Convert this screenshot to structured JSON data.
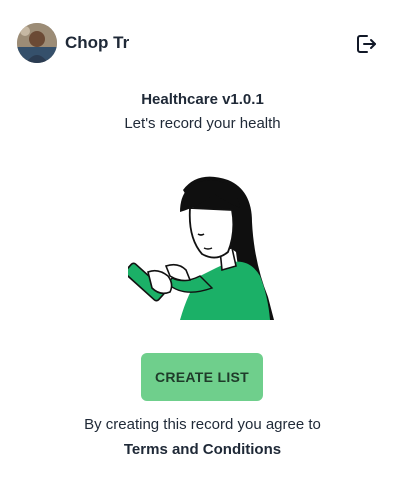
{
  "header": {
    "user_name": "Chop Tr",
    "avatar_icon": "user-avatar",
    "logout_icon": "logout-icon"
  },
  "main": {
    "title": "Healthcare v1.0.1",
    "subtitle": "Let's record your health",
    "illustration_icon": "woman-with-phone-illustration",
    "create_button_label": "CREATE LIST",
    "agree_text": "By creating this record you agree to",
    "terms_link": "Terms and Conditions"
  },
  "colors": {
    "accent_green": "#6fcf8c",
    "text_dark": "#1f2937"
  }
}
